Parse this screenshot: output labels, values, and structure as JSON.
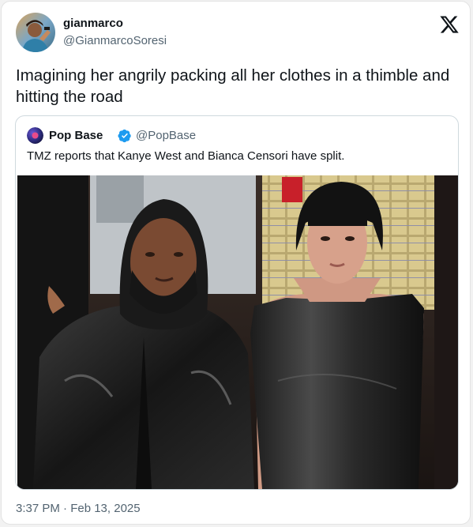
{
  "tweet": {
    "display_name": "gianmarco",
    "handle": "@GianmarcoSoresi",
    "text": "Imagining her angrily packing all her clothes in a thimble and hitting the road",
    "timestamp": "3:37 PM · Feb 13, 2025",
    "platform_icon": "x-logo-icon"
  },
  "quoted_tweet": {
    "display_name": "Pop Base",
    "handle": "@PopBase",
    "verified": true,
    "text": "TMZ reports that Kanye West and Bianca Censori have split.",
    "verified_color": "#1d9bf0"
  },
  "colors": {
    "text_primary": "#0f1419",
    "text_secondary": "#536471",
    "border": "#cfd9de"
  }
}
